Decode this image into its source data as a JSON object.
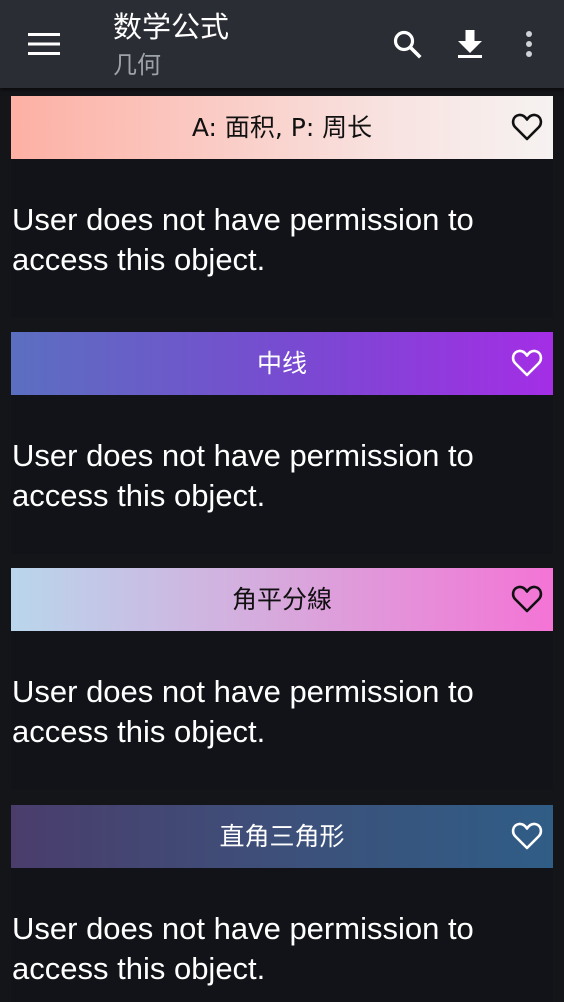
{
  "appbar": {
    "title": "数学公式",
    "subtitle": "几何",
    "icons": {
      "menu": "hamburger-menu-icon",
      "search": "search-icon",
      "download": "download-icon",
      "more": "more-vert-icon"
    }
  },
  "cards": [
    {
      "title": "A: 面积, P: 周长",
      "body": "User does not have permission to access this object.",
      "gradient": [
        "#fdb0a4",
        "#f6f2f1"
      ],
      "favorite_icon": "heart-outline-icon"
    },
    {
      "title": "中线",
      "body": "User does not have permission to access this object.",
      "gradient": [
        "#5b6fc0",
        "#a42ee6"
      ],
      "favorite_icon": "heart-outline-icon"
    },
    {
      "title": "角平分線",
      "body": "User does not have permission to access this object.",
      "gradient": [
        "#b9d6ec",
        "#f474d6"
      ],
      "favorite_icon": "heart-outline-icon"
    },
    {
      "title": "直角三角形",
      "body": "User does not have permission to access this object.",
      "gradient": [
        "#4a3d6c",
        "#2f5d86"
      ],
      "favorite_icon": "heart-outline-icon"
    }
  ],
  "colors": {
    "appbar": "#2a2d33",
    "background": "#141519",
    "subtitle": "#9ea3aa"
  }
}
